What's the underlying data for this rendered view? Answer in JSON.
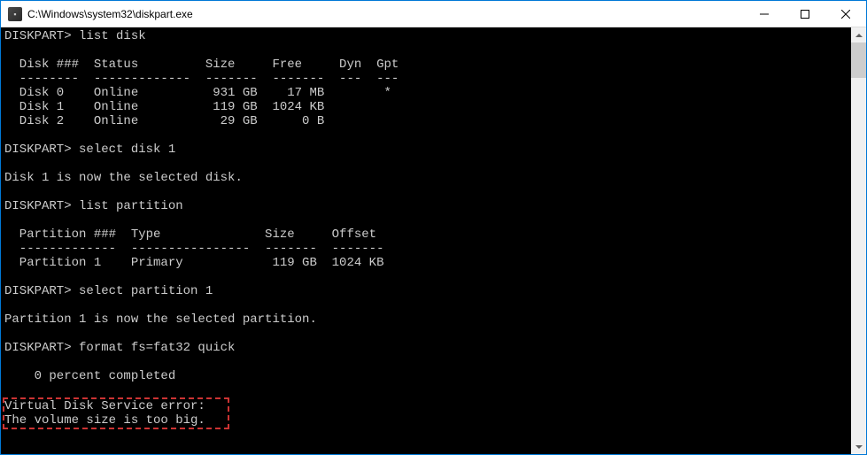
{
  "titlebar": {
    "title": "C:\\Windows\\system32\\diskpart.exe"
  },
  "terminal": {
    "lines": [
      "DISKPART> list disk",
      "",
      "  Disk ###  Status         Size     Free     Dyn  Gpt",
      "  --------  -------------  -------  -------  ---  ---",
      "  Disk 0    Online          931 GB    17 MB        *",
      "  Disk 1    Online          119 GB  1024 KB",
      "  Disk 2    Online           29 GB      0 B",
      "",
      "DISKPART> select disk 1",
      "",
      "Disk 1 is now the selected disk.",
      "",
      "DISKPART> list partition",
      "",
      "  Partition ###  Type              Size     Offset",
      "  -------------  ----------------  -------  -------",
      "  Partition 1    Primary            119 GB  1024 KB",
      "",
      "DISKPART> select partition 1",
      "",
      "Partition 1 is now the selected partition.",
      "",
      "DISKPART> format fs=fat32 quick",
      "",
      "    0 percent completed",
      ""
    ],
    "error_lines": [
      "Virtual Disk Service error:   ",
      "The volume size is too big.   "
    ]
  }
}
